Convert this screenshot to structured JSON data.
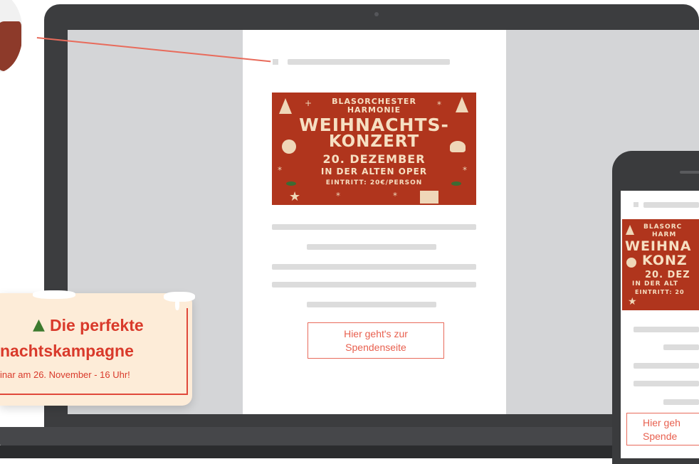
{
  "banner": {
    "line1": "BLASORCHESTER",
    "line2": "HARMONIE",
    "line3": "WEIHNACHTS-",
    "line4": "KONZERT",
    "line5": "20. DEZEMBER",
    "line6": "IN DER ALTEN OPER",
    "line7": "EINTRITT: 20€/PERSON"
  },
  "email": {
    "donate_label_line1": "Hier geht's zur",
    "donate_label_line2": "Spendenseite"
  },
  "phone": {
    "banner_line1": "BLASORC",
    "banner_line2": "HARM",
    "banner_line3": "WEIHNA",
    "banner_line4": "KONZ",
    "banner_line5": "20. DEZ",
    "banner_line6": "IN DER ALT",
    "banner_line7": "EINTRITT: 20",
    "donate_label_line1": "Hier geh",
    "donate_label_line2": "Spende"
  },
  "webinar": {
    "title_line1": "Die perfekte",
    "title_line2": "nachtskampagne",
    "subtitle": "inar am 26. November - 16 Uhr!"
  },
  "colors": {
    "accent": "#e0483a",
    "banner_bg": "#b0351d",
    "banner_text": "#f6dfc2",
    "card_bg": "#fdecd8"
  }
}
